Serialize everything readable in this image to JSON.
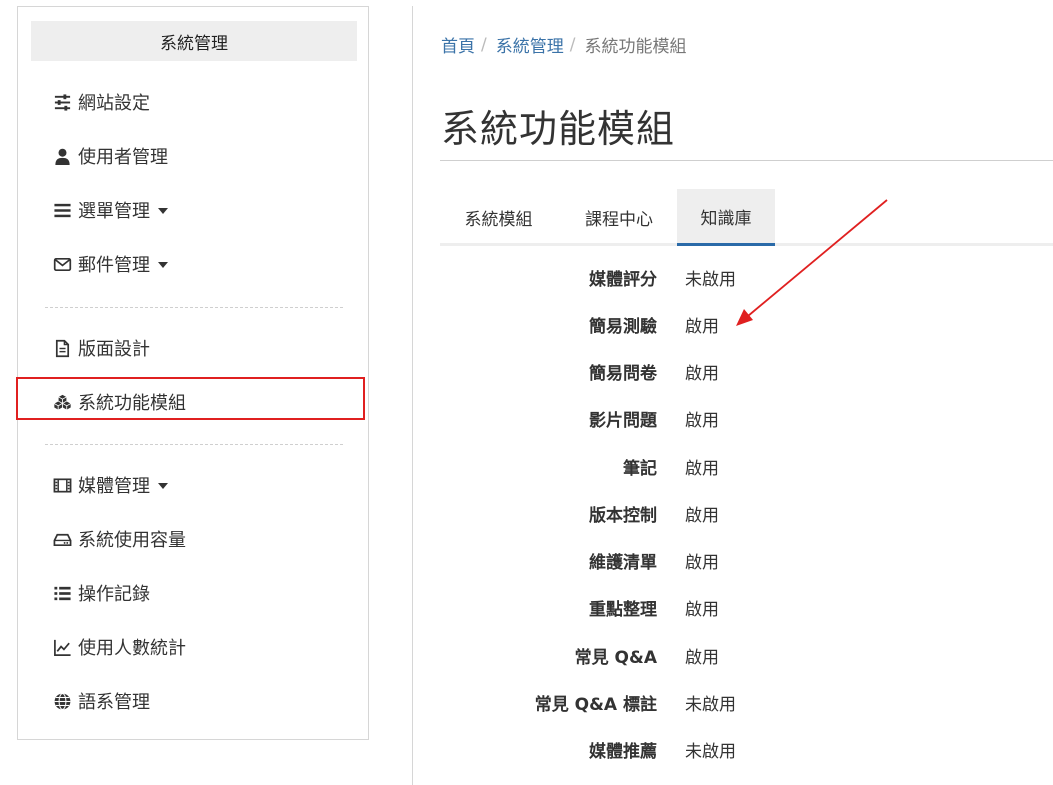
{
  "sidebar": {
    "header": "系統管理",
    "items": [
      {
        "label": "網站設定",
        "icon": "sliders-icon",
        "caret": false
      },
      {
        "label": "使用者管理",
        "icon": "user-icon",
        "caret": false
      },
      {
        "label": "選單管理",
        "icon": "menu-lines-icon",
        "caret": true
      },
      {
        "label": "郵件管理",
        "icon": "envelope-icon",
        "caret": true
      },
      {
        "label": "版面設計",
        "icon": "file-icon",
        "caret": false
      },
      {
        "label": "系統功能模組",
        "icon": "cubes-icon",
        "caret": false
      },
      {
        "label": "媒體管理",
        "icon": "film-icon",
        "caret": true
      },
      {
        "label": "系統使用容量",
        "icon": "hdd-icon",
        "caret": false
      },
      {
        "label": "操作記錄",
        "icon": "list-icon",
        "caret": false
      },
      {
        "label": "使用人數統計",
        "icon": "line-chart-icon",
        "caret": false
      },
      {
        "label": "語系管理",
        "icon": "globe-icon",
        "caret": false
      }
    ]
  },
  "breadcrumb": {
    "home": "首頁",
    "parent": "系統管理",
    "current": "系統功能模組",
    "separator": "/"
  },
  "page_title": "系統功能模組",
  "tabs": [
    {
      "label": "系統模組",
      "active": false
    },
    {
      "label": "課程中心",
      "active": false
    },
    {
      "label": "知識庫",
      "active": true
    }
  ],
  "settings": [
    {
      "label": "媒體評分",
      "value": "未啟用"
    },
    {
      "label": "簡易測驗",
      "value": "啟用"
    },
    {
      "label": "簡易問卷",
      "value": "啟用"
    },
    {
      "label": "影片問題",
      "value": "啟用"
    },
    {
      "label": "筆記",
      "value": "啟用"
    },
    {
      "label": "版本控制",
      "value": "啟用"
    },
    {
      "label": "維護清單",
      "value": "啟用"
    },
    {
      "label": "重點整理",
      "value": "啟用"
    },
    {
      "label": "常見 Q&A",
      "value": "啟用"
    },
    {
      "label": "常見 Q&A 標註",
      "value": "未啟用"
    },
    {
      "label": "媒體推薦",
      "value": "未啟用"
    }
  ],
  "colors": {
    "link": "#3b73a8",
    "active_tab_border": "#2a6aa8",
    "highlight": "#e02020",
    "annotation_arrow": "#e02020"
  }
}
